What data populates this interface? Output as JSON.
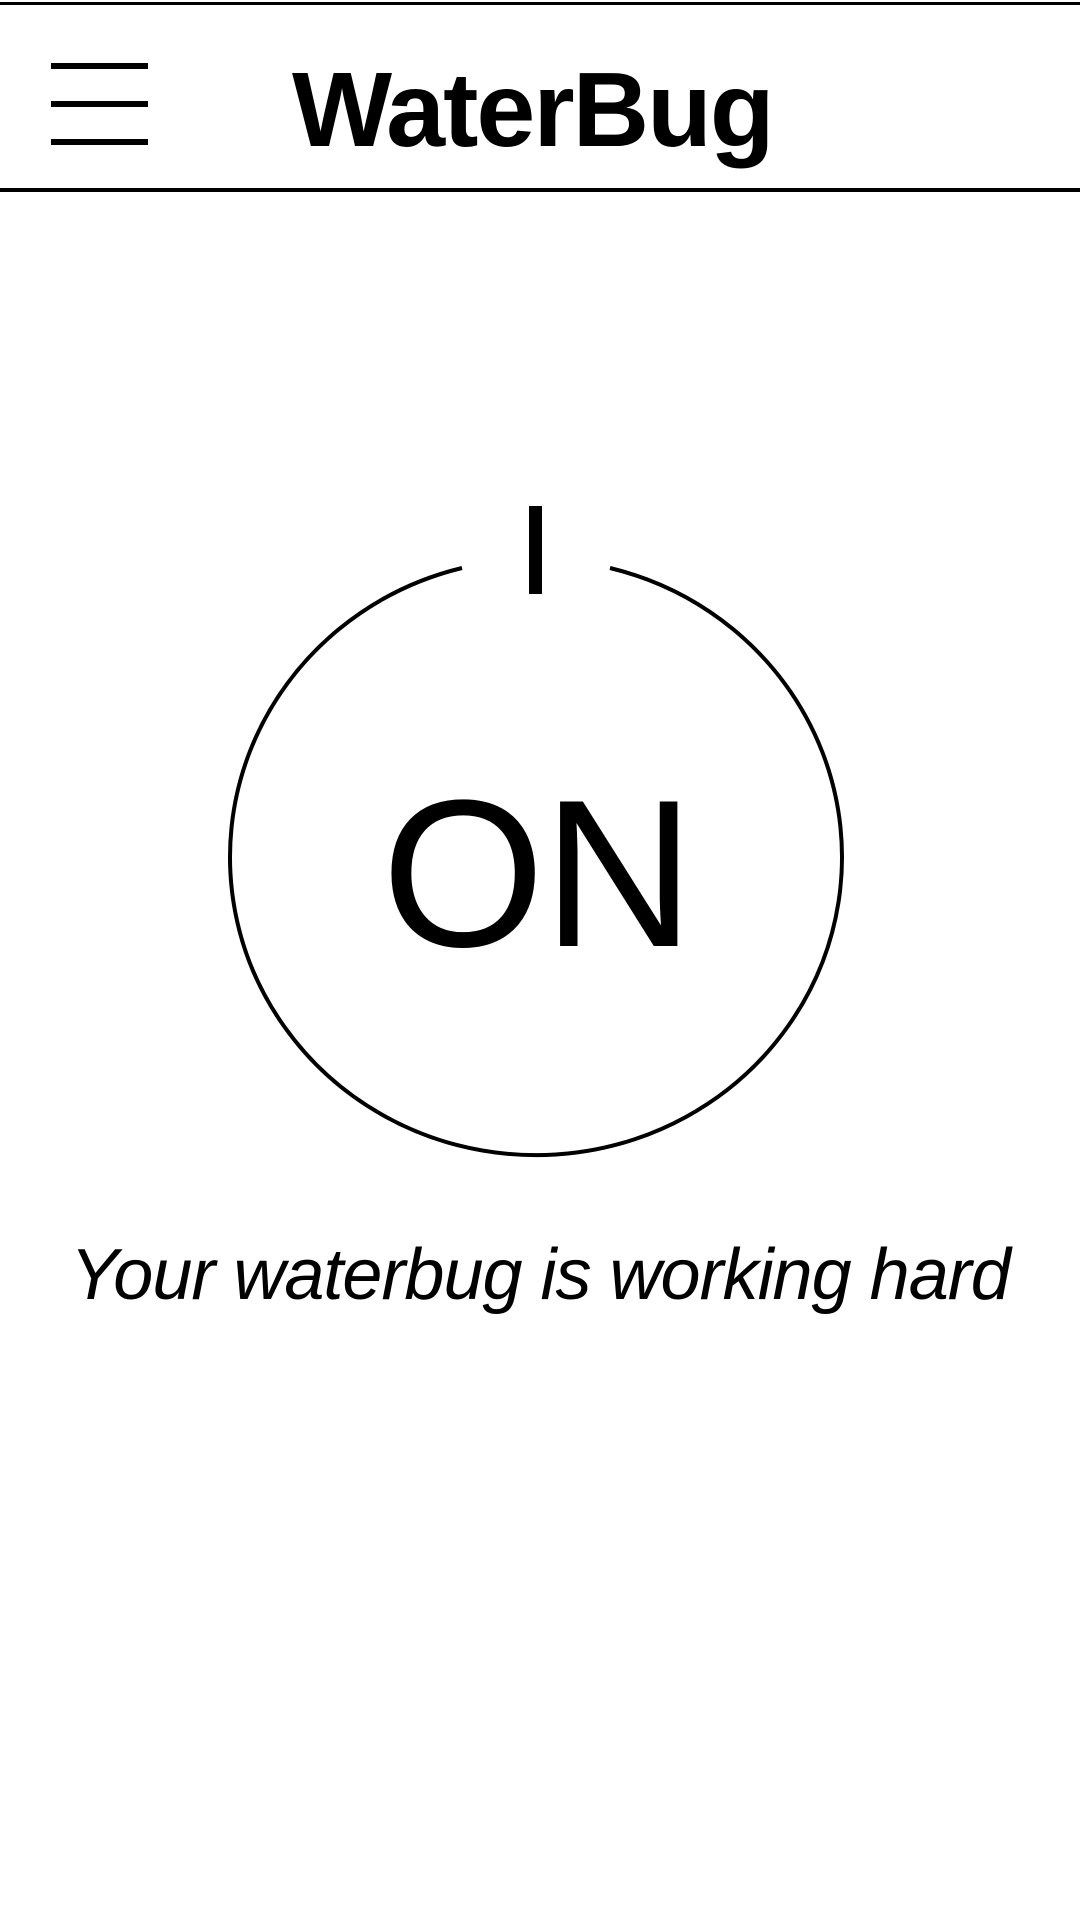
{
  "app_bar": {
    "title": "WaterBug",
    "menu_icon": "hamburger-menu-icon"
  },
  "power": {
    "state_label": "ON",
    "icon": "power-icon"
  },
  "status": {
    "message": "Your waterbug is working hard"
  },
  "colors": {
    "background": "#ffffff",
    "foreground": "#000000"
  }
}
